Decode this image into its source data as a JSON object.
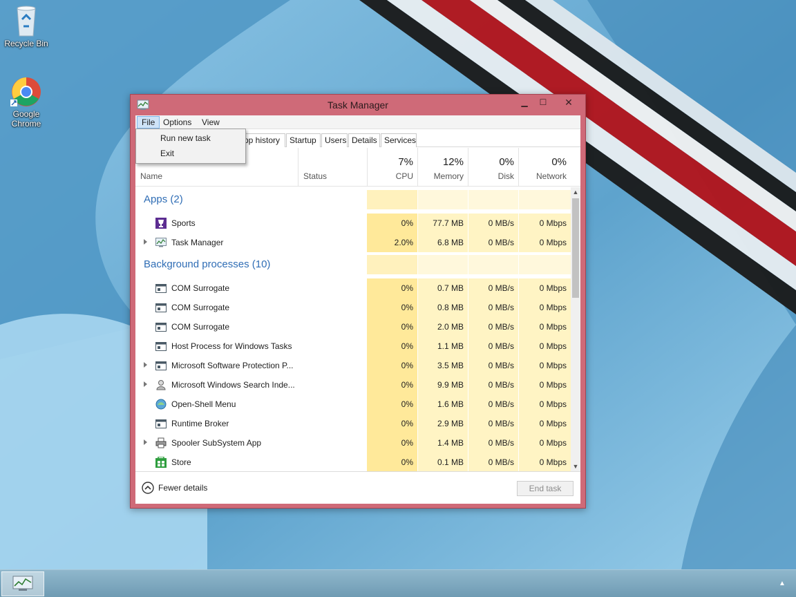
{
  "desktop": {
    "icons": [
      {
        "label": "Recycle Bin",
        "icon": "recycle-bin-icon"
      },
      {
        "label": "Google\nChrome",
        "icon": "chrome-icon"
      }
    ]
  },
  "window": {
    "title": "Task Manager",
    "icon": "task-manager-icon",
    "controls": {
      "minimize": "▁",
      "maximize": "☐",
      "close": "✕"
    }
  },
  "menubar": {
    "file": "File",
    "options": "Options",
    "view": "View"
  },
  "file_menu": {
    "items": [
      "Run new task",
      "Exit"
    ]
  },
  "tabs": [
    "App history",
    "Startup",
    "Users",
    "Details",
    "Services"
  ],
  "visible_tab_fragment": "pp history",
  "columns": {
    "name": "Name",
    "status": "Status",
    "cpu": {
      "pct": "7%",
      "label": "CPU"
    },
    "memory": {
      "pct": "12%",
      "label": "Memory"
    },
    "disk": {
      "pct": "0%",
      "label": "Disk"
    },
    "network": {
      "pct": "0%",
      "label": "Network"
    }
  },
  "groups": {
    "apps": "Apps (2)",
    "background": "Background processes (10)"
  },
  "apps": [
    {
      "name": "Sports",
      "icon": "sports-trophy-icon",
      "expandable": false,
      "cpu": "0%",
      "memory": "77.7 MB",
      "disk": "0 MB/s",
      "network": "0 Mbps"
    },
    {
      "name": "Task Manager",
      "icon": "task-manager-icon",
      "expandable": true,
      "cpu": "2.0%",
      "memory": "6.8 MB",
      "disk": "0 MB/s",
      "network": "0 Mbps"
    }
  ],
  "background": [
    {
      "name": "COM Surrogate",
      "icon": "window-app-icon",
      "expandable": false,
      "cpu": "0%",
      "memory": "0.7 MB",
      "disk": "0 MB/s",
      "network": "0 Mbps"
    },
    {
      "name": "COM Surrogate",
      "icon": "window-app-icon",
      "expandable": false,
      "cpu": "0%",
      "memory": "0.8 MB",
      "disk": "0 MB/s",
      "network": "0 Mbps"
    },
    {
      "name": "COM Surrogate",
      "icon": "window-app-icon",
      "expandable": false,
      "cpu": "0%",
      "memory": "2.0 MB",
      "disk": "0 MB/s",
      "network": "0 Mbps"
    },
    {
      "name": "Host Process for Windows Tasks",
      "icon": "window-app-icon",
      "expandable": false,
      "cpu": "0%",
      "memory": "1.1 MB",
      "disk": "0 MB/s",
      "network": "0 Mbps"
    },
    {
      "name": "Microsoft Software Protection P...",
      "icon": "window-app-icon",
      "expandable": true,
      "cpu": "0%",
      "memory": "3.5 MB",
      "disk": "0 MB/s",
      "network": "0 Mbps"
    },
    {
      "name": "Microsoft Windows Search Inde...",
      "icon": "search-indexer-icon",
      "expandable": true,
      "cpu": "0%",
      "memory": "9.9 MB",
      "disk": "0 MB/s",
      "network": "0 Mbps"
    },
    {
      "name": "Open-Shell Menu",
      "icon": "open-shell-icon",
      "expandable": false,
      "cpu": "0%",
      "memory": "1.6 MB",
      "disk": "0 MB/s",
      "network": "0 Mbps"
    },
    {
      "name": "Runtime Broker",
      "icon": "window-app-icon",
      "expandable": false,
      "cpu": "0%",
      "memory": "2.9 MB",
      "disk": "0 MB/s",
      "network": "0 Mbps"
    },
    {
      "name": "Spooler SubSystem App",
      "icon": "printer-icon",
      "expandable": true,
      "cpu": "0%",
      "memory": "1.4 MB",
      "disk": "0 MB/s",
      "network": "0 Mbps"
    },
    {
      "name": "Store",
      "icon": "store-icon",
      "expandable": false,
      "cpu": "0%",
      "memory": "0.1 MB",
      "disk": "0 MB/s",
      "network": "0 Mbps"
    }
  ],
  "footer": {
    "fewer_details": "Fewer details",
    "end_task": "End task"
  },
  "colors": {
    "window_frame": "#cf6a78",
    "group_title": "#2f6db5",
    "heat_light": "#fff4c4",
    "heat_medium": "#ffe99a",
    "taskbar": "#7aa8c0"
  }
}
